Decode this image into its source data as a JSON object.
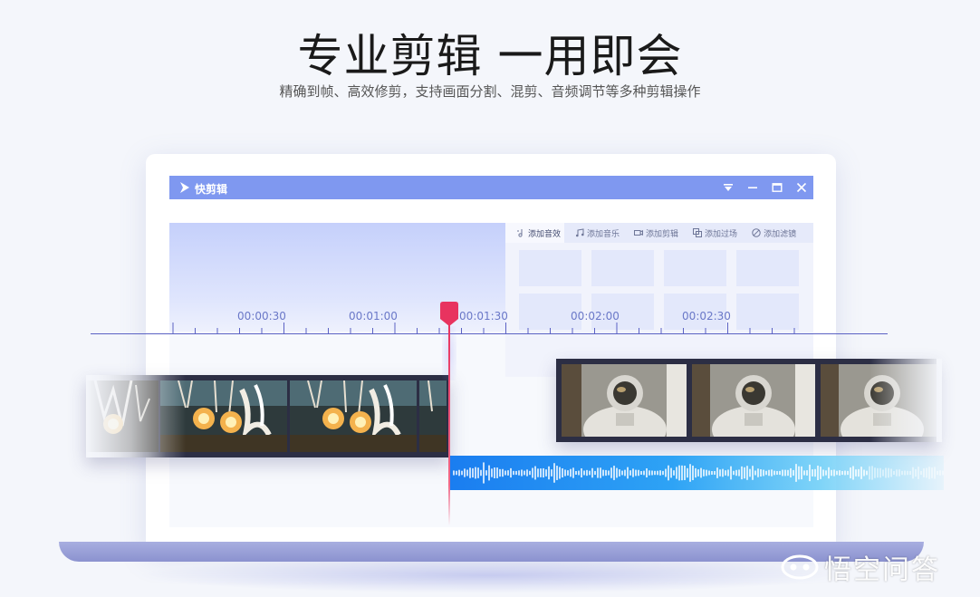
{
  "hero": {
    "title": "专业剪辑 一用即会",
    "subtitle": "精确到帧、高效修剪，支持画面分割、混剪、音频调节等多种剪辑操作"
  },
  "app": {
    "title": "快剪辑",
    "window_controls": [
      "dropdown-icon",
      "minimize-icon",
      "maximize-icon",
      "close-icon"
    ],
    "tabs": [
      {
        "label": "添加音效",
        "icon": "sound-effect-icon",
        "active": true
      },
      {
        "label": "添加音乐",
        "icon": "music-note-icon",
        "active": false
      },
      {
        "label": "添加剪辑",
        "icon": "video-camera-icon",
        "active": false
      },
      {
        "label": "添加过场",
        "icon": "transition-icon",
        "active": false
      },
      {
        "label": "添加滤镜",
        "icon": "filter-icon",
        "active": false
      }
    ]
  },
  "timeline": {
    "ticks": [
      "00:00:30",
      "00:01:00",
      "00:01:30",
      "00:02:00",
      "00:02:30"
    ],
    "playhead": "00:01:20"
  },
  "watermark": {
    "text": "悟空问答",
    "icon": "wukong-logo-icon"
  },
  "colors": {
    "title_bar": "#7f98f0",
    "playhead": "#e8335f",
    "audio_start": "#1a7df0",
    "audio_end": "#7fd4f8"
  }
}
